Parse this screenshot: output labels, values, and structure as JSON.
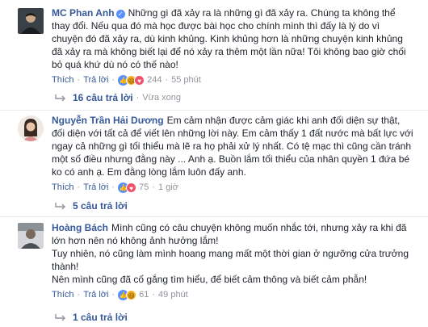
{
  "comments": [
    {
      "author": "MC Phan Anh",
      "text": "Những gì đã xảy ra là những gì đã xảy ra. Chúng ta không thể thay đổi. Nếu qua đó mà học được bài học cho chính mình thì đấy là lý do vì chuyện đó đã xảy ra, dù kinh khủng. Kinh khủng hơn là những chuyện kinh khủng đã xảy ra mà không biết lại để nó xảy ra thêm một lần nữa! Tôi không bao giờ chối bỏ quá khứ dù nó có thế nào!",
      "like_label": "Thích",
      "reply_label": "Trả lời",
      "reaction_count": "244",
      "time": "55 phút",
      "replies_label": "16 câu trả lời",
      "replies_time": "Vừa xong"
    },
    {
      "author": "Nguyễn Trần Hải Dương",
      "text": "Em cảm nhận được cảm giác khi anh đối diện sự thật, đối diện với tất cả để viết lên những lời này. Em cảm thấy 1 đất nước mà bất lực với ngay cả những gì tối thiểu mà lẽ ra họ phải xử lý nhất. Có tệ mạc thì cũng cần tránh một số điều nhưng đằng này ... Anh ạ. Buồn lắm tối thiểu của nhân quyền 1 đứa bé ko có anh ạ. Em đằng lòng lắm luôn đấy anh.",
      "like_label": "Thích",
      "reply_label": "Trả lời",
      "reaction_count": "75",
      "time": "1 giờ",
      "replies_label": "5 câu trả lời"
    },
    {
      "author": "Hoàng Bách",
      "text": "Mình cũng có câu chuyện không muốn nhắc tới, nhưng xảy ra khi đã lớn hơn nên nó không ảnh hưởng lắm!",
      "text2": "Tuy nhiên, nó cũng làm mình hoang mang mất một thời gian ở ngưỡng cửa trưởng thành!",
      "text3": "Nên mình cũng đã cố gắng tìm hiểu, để biết cảm thông và biết cảm phẫn!",
      "like_label": "Thích",
      "reply_label": "Trả lời",
      "reaction_count": "61",
      "time": "49 phút",
      "replies_label": "1 câu trả lời"
    }
  ],
  "colors": {
    "link": "#365899",
    "meta": "#90949c",
    "like": "#5890ff",
    "haha": "#f7b125",
    "love": "#f25268"
  }
}
